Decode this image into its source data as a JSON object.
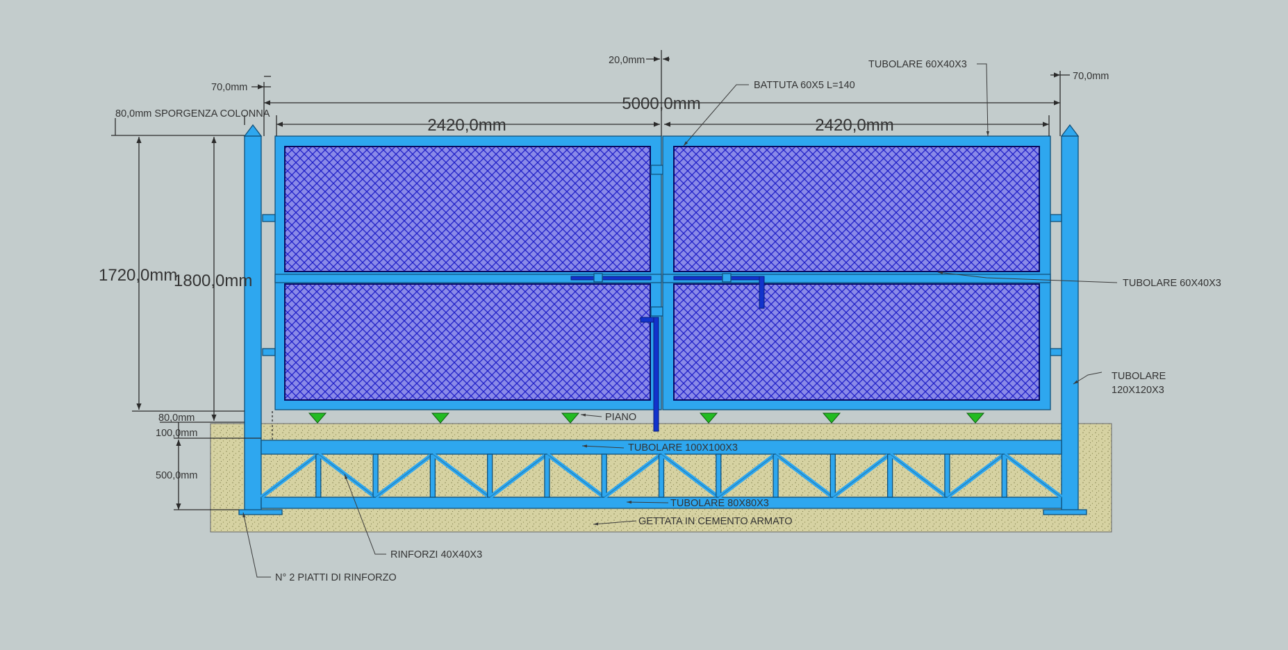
{
  "dimensions": {
    "total_width": "5000,0mm",
    "leaf_left": "2420,0mm",
    "leaf_right": "2420,0mm",
    "gap_center": "20,0mm",
    "post_left": "70,0mm",
    "post_right": "70,0mm",
    "post_protrusion": "80,0mm SPORGENZA COLONNA",
    "panel_height": "1720,0mm",
    "overall_height": "1800,0mm",
    "ground_gap": "80,0mm",
    "beam_height": "100,0mm",
    "foundation_depth": "500,0mm"
  },
  "labels": {
    "tubolare_top": "TUBOLARE 60X40X3",
    "battuta": "BATTUTA 60X5 L=140",
    "tubolare_middle": "TUBOLARE 60X40X3",
    "tubolare_post_l1": "TUBOLARE",
    "tubolare_post_l2": "120X120X3",
    "piano": "PIANO",
    "tubolare_beam": "TUBOLARE 100X100X3",
    "tubolare_bottom": "TUBOLARE 80X80X3",
    "concrete": "GETTATA IN CEMENTO ARMATO",
    "rinforzi": "RINFORZI 40X40X3",
    "piatti": "N° 2 PIATTI DI RINFORZO"
  },
  "colors": {
    "background": "#c3cccc",
    "steel": "#2ea7ef",
    "mesh": "#2a2ad0",
    "concrete": "#d6d2a2",
    "level_marker": "#22bb22"
  }
}
